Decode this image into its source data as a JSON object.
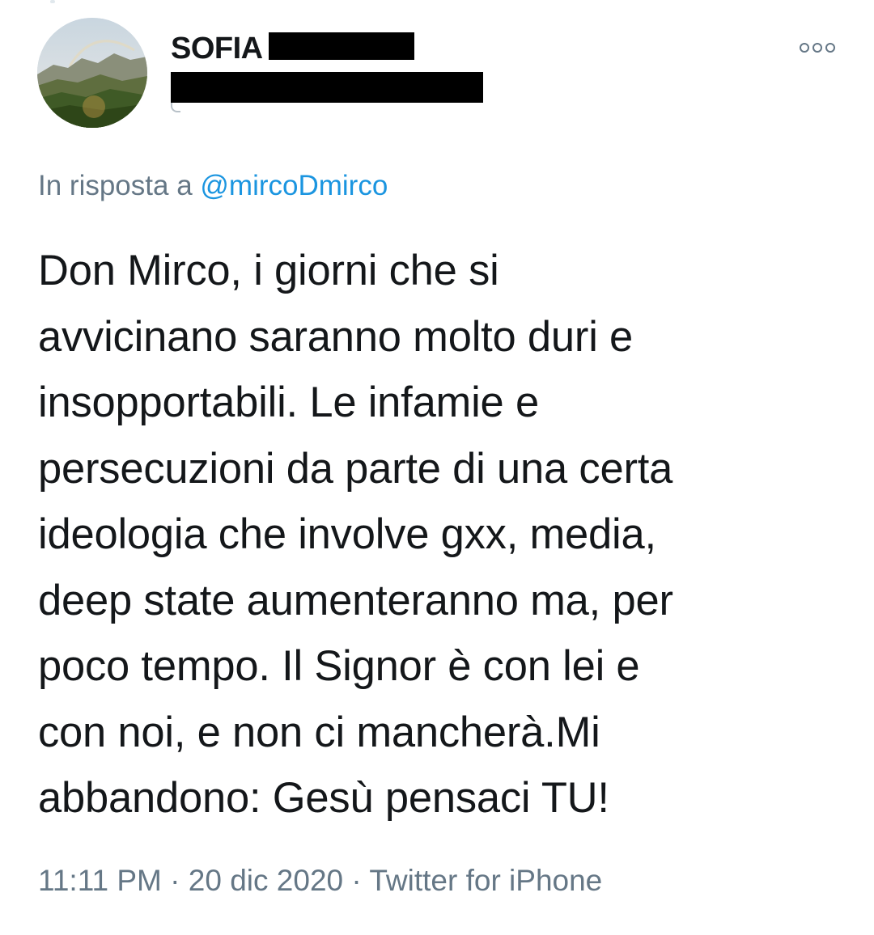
{
  "tweet": {
    "author": {
      "display_name_visible": "SOFIA",
      "avatar": "landscape-rainbow-avatar"
    },
    "more_icon": "more-options-icon",
    "reply": {
      "prefix": "In risposta a",
      "mention": "@mircoDmirco"
    },
    "text": "Don Mirco, i giorni che si\navvicinano saranno molto duri e\ninsopportabili. Le infamie e\npersecuzioni da parte di una certa\nideologia che involve gxx, media,\ndeep state aumenteranno ma, per\npoco tempo. Il Signor è con lei e\ncon noi, e non ci mancherà.Mi\nabbandono: Gesù pensaci TU!",
    "meta": {
      "time": "11:11 PM",
      "separator": "·",
      "date": "20 dic 2020",
      "source": "Twitter for iPhone"
    }
  },
  "colors": {
    "text": "#14171a",
    "secondary": "#657786",
    "link": "#1b95e0",
    "redaction": "#000000"
  }
}
